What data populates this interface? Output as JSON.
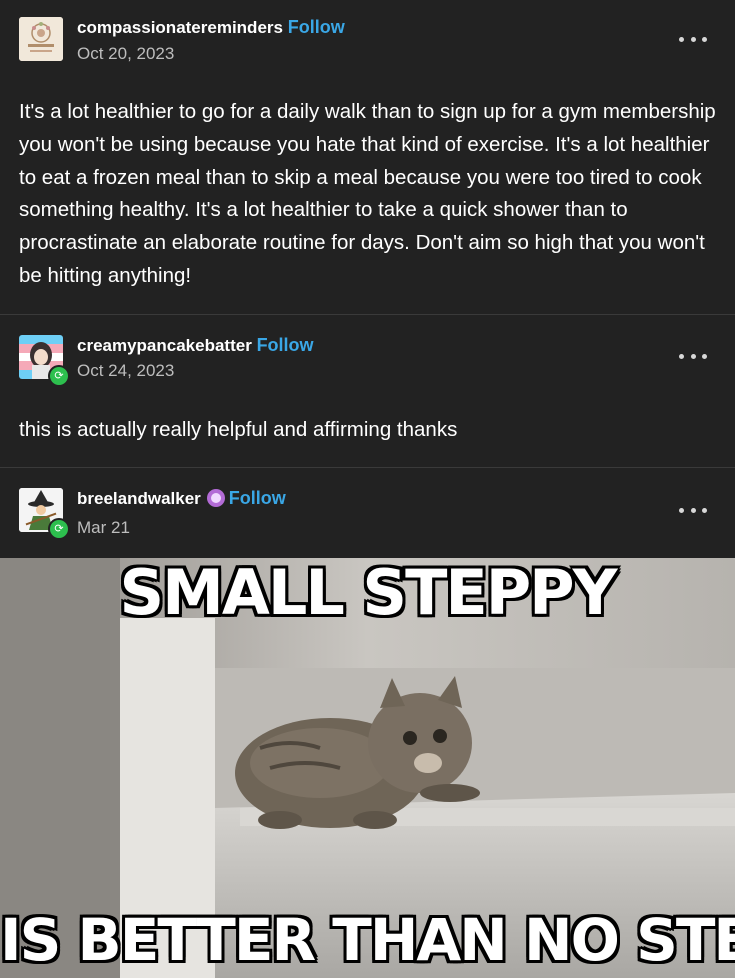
{
  "posts": [
    {
      "username": "compassionatereminders",
      "follow": "Follow",
      "date": "Oct 20, 2023",
      "avatar_icon": "flower-wreath-avatar",
      "text": "It's a lot healthier to go for a daily walk than to sign up for a gym membership you won't be using because you hate that kind of exercise. It's a lot healthier to eat a frozen meal than to skip a meal because you were too tired to cook something healthy. It's a lot healthier to take a quick shower than to procrastinate an elaborate routine for days. Don't aim so high that you won't be hitting anything!"
    },
    {
      "username": "creamypancakebatter",
      "follow": "Follow",
      "date": "Oct 24, 2023",
      "avatar_icon": "anime-character-avatar",
      "text": "this is actually really helpful and affirming thanks"
    },
    {
      "username": "breelandwalker",
      "follow": "Follow",
      "date": "Mar 21",
      "avatar_icon": "witch-avatar"
    }
  ],
  "meme": {
    "top_caption": "SMALL STEPPY",
    "bottom_caption": "IS BETTER THAN NO STEPPY"
  },
  "colors": {
    "background": "#222222",
    "follow": "#3aa7e6",
    "reblog_badge": "#2dbf4e"
  }
}
